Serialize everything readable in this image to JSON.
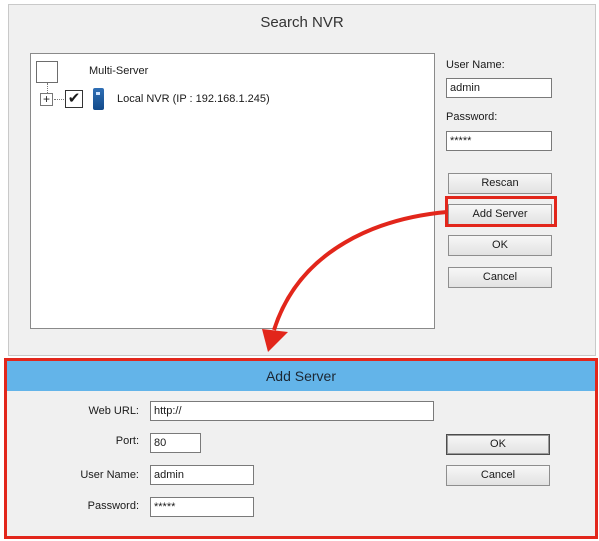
{
  "search_dialog": {
    "title": "Search NVR",
    "tree": {
      "multi_server_label": "Multi-Server",
      "expand_symbol": "+",
      "check_mark": "✔",
      "nvr_label": "Local NVR (IP : 192.168.1.245)",
      "nvr_checked": true,
      "nvr_icon": "server-icon"
    },
    "user_name_label": "User Name:",
    "user_name_value": "admin",
    "password_label": "Password:",
    "password_value": "*****",
    "buttons": {
      "rescan": "Rescan",
      "add_server": "Add Server",
      "ok": "OK",
      "cancel": "Cancel"
    }
  },
  "add_server_dialog": {
    "title": "Add Server",
    "web_url_label": "Web URL:",
    "web_url_value": "http://",
    "port_label": "Port:",
    "port_value": "80",
    "user_name_label": "User Name:",
    "user_name_value": "admin",
    "password_label": "Password:",
    "password_value": "*****",
    "buttons": {
      "ok": "OK",
      "cancel": "Cancel"
    }
  },
  "colors": {
    "highlight": "#e2261b",
    "titlebar": "#63b4e9",
    "dialog_bg": "#f0f0f0"
  }
}
